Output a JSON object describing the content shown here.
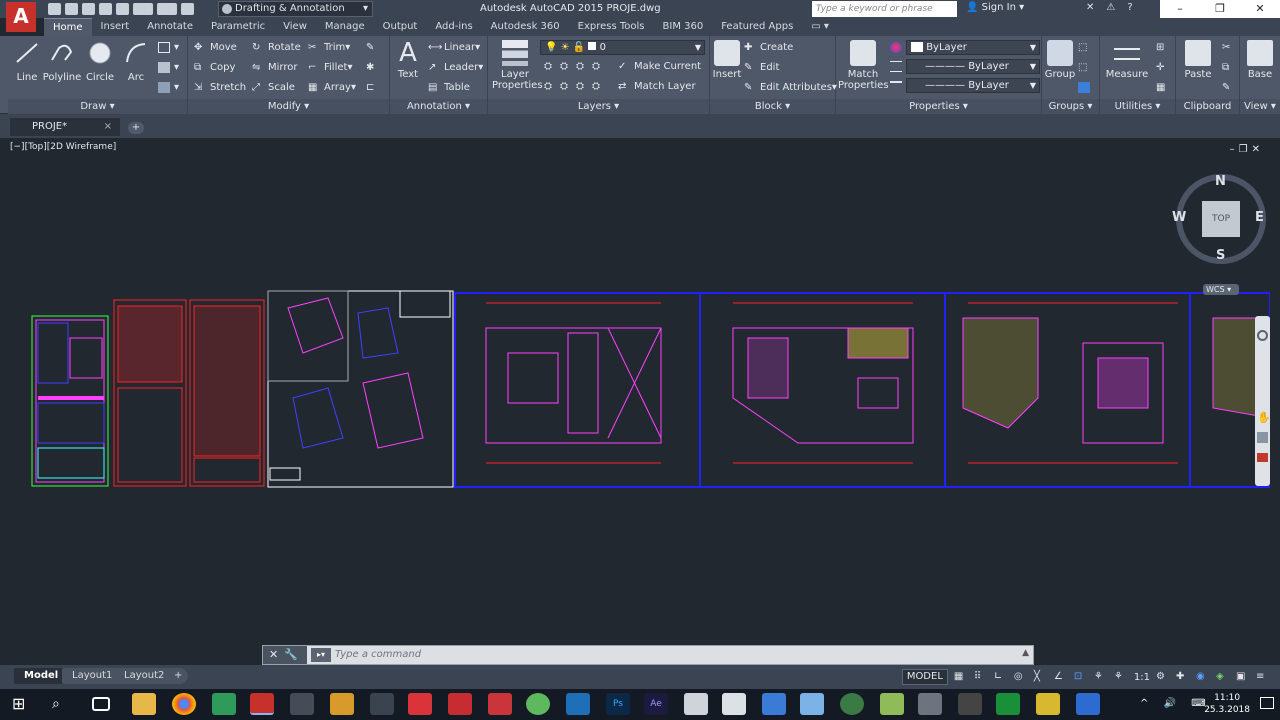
{
  "titlebar": {
    "app_letter": "A",
    "workspace": "Drafting & Annotation",
    "title": "Autodesk AutoCAD 2015    PROJE.dwg",
    "search_placeholder": "Type a keyword or phrase",
    "signin": "Sign In"
  },
  "tabs": [
    "Home",
    "Insert",
    "Annotate",
    "Parametric",
    "View",
    "Manage",
    "Output",
    "Add-ins",
    "Autodesk 360",
    "Express Tools",
    "BIM 360",
    "Featured Apps"
  ],
  "ribbon": {
    "draw": {
      "title": "Draw",
      "line": "Line",
      "polyline": "Polyline",
      "circle": "Circle",
      "arc": "Arc"
    },
    "modify": {
      "title": "Modify",
      "move": "Move",
      "rotate": "Rotate",
      "trim": "Trim",
      "copy": "Copy",
      "mirror": "Mirror",
      "fillet": "Fillet",
      "stretch": "Stretch",
      "scale": "Scale",
      "array": "Array"
    },
    "annotation": {
      "title": "Annotation",
      "text": "Text",
      "linear": "Linear",
      "leader": "Leader",
      "table": "Table"
    },
    "layers": {
      "title": "Layers",
      "layer_properties_1": "Layer",
      "layer_properties_2": "Properties",
      "current_layer": "0",
      "make_current": "Make Current",
      "match_layer": "Match Layer"
    },
    "block": {
      "title": "Block",
      "insert": "Insert",
      "create": "Create",
      "edit": "Edit",
      "edit_attributes": "Edit Attributes"
    },
    "properties": {
      "title": "Properties",
      "match_1": "Match",
      "match_2": "Properties",
      "color": "ByLayer",
      "linetype": "ByLayer",
      "lineweight": "ByLayer"
    },
    "groups": {
      "title": "Groups",
      "group": "Group"
    },
    "utilities": {
      "title": "Utilities",
      "measure": "Measure"
    },
    "clipboard": {
      "title": "Clipboard",
      "paste": "Paste"
    },
    "view": {
      "title": "View",
      "base": "Base"
    }
  },
  "doc_tab": {
    "name": "PROJE*"
  },
  "viewport": {
    "label": "[−][Top][2D Wireframe]"
  },
  "viewcube": {
    "north": "N",
    "south": "S",
    "east": "E",
    "west": "W",
    "face": "TOP",
    "wcs": "WCS"
  },
  "command": {
    "placeholder": "Type a command"
  },
  "layout_tabs": [
    "Model",
    "Layout1",
    "Layout2"
  ],
  "status": {
    "model": "MODEL",
    "scale": "1:1"
  },
  "clock": {
    "time": "11:10",
    "date": "25.3.2018"
  },
  "colors": {
    "magenta": "#e040e0",
    "red": "#ff2020",
    "blue": "#2020ff",
    "yellow": "#ffe040",
    "white": "#ffffff",
    "accent": "#c6312b"
  }
}
